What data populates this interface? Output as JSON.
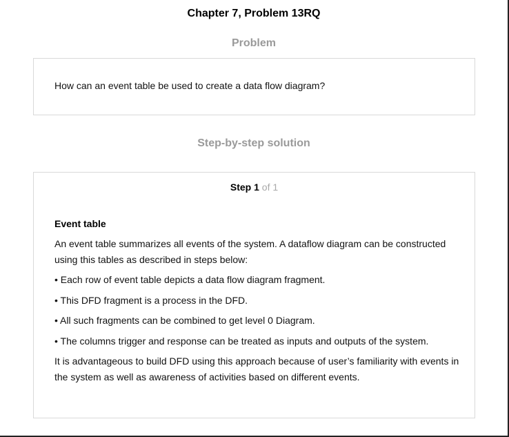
{
  "header": {
    "title": "Chapter 7, Problem 13RQ"
  },
  "problem": {
    "heading": "Problem",
    "text": "How can an event table be used to create a data flow diagram?"
  },
  "solution": {
    "heading": "Step-by-step solution",
    "step": {
      "word": "Step",
      "number": "1",
      "of_text": "of 1"
    },
    "content": {
      "heading": "Event table",
      "intro": "An event table summarizes all events of the system. A dataflow diagram can be constructed using this tables as described in steps below:",
      "bullets": [
        "• Each row of event table depicts a data flow diagram fragment.",
        "• This DFD fragment is a process in the DFD.",
        "• All such fragments can be combined to get level 0 Diagram.",
        "• The columns trigger and response can be treated as inputs and outputs of the system."
      ],
      "conclusion": "It is advantageous to build DFD using this approach because of user’s familiarity with events in the system as well as awareness of activities based on different events."
    }
  },
  "colors": {
    "heading_gray": "#9a9a9a",
    "box_border": "#d9d9d9",
    "step_of_gray": "#a8a8a8"
  }
}
